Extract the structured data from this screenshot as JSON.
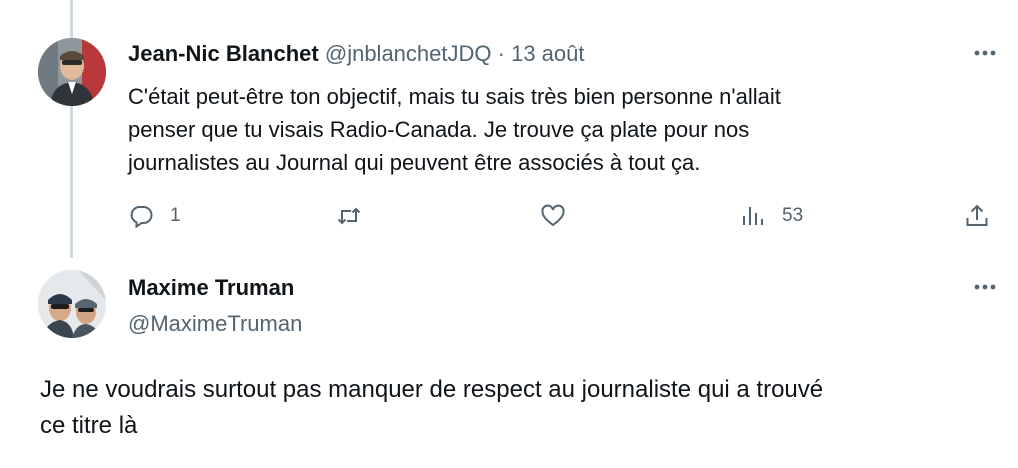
{
  "tweets": [
    {
      "author_name": "Jean-Nic Blanchet",
      "handle": "@jnblanchetJDQ",
      "separator": "·",
      "date": "13 août",
      "text_lines": [
        "C'était peut-être ton objectif, mais tu sais très bien personne n'allait",
        "penser que tu visais Radio-Canada. Je trouve ça plate pour nos",
        "journalistes au Journal qui peuvent être associés à tout ça."
      ],
      "actions": {
        "reply_count": "1",
        "retweet_count": "",
        "like_count": "",
        "views_count": "53"
      },
      "more_icon": "more-horizontal-icon"
    },
    {
      "author_name": "Maxime Truman",
      "handle": "@MaximeTruman",
      "text_lines": [
        "Je ne voudrais surtout pas manquer de respect au journaliste qui a trouvé",
        "ce titre là"
      ],
      "more_icon": "more-horizontal-icon"
    }
  ],
  "icons": {
    "reply": "reply-icon",
    "retweet": "retweet-icon",
    "like": "heart-icon",
    "views": "views-icon",
    "share": "share-icon"
  },
  "colors": {
    "text": "#0f1419",
    "secondary": "#536471",
    "thread_line": "#cfd9de"
  }
}
